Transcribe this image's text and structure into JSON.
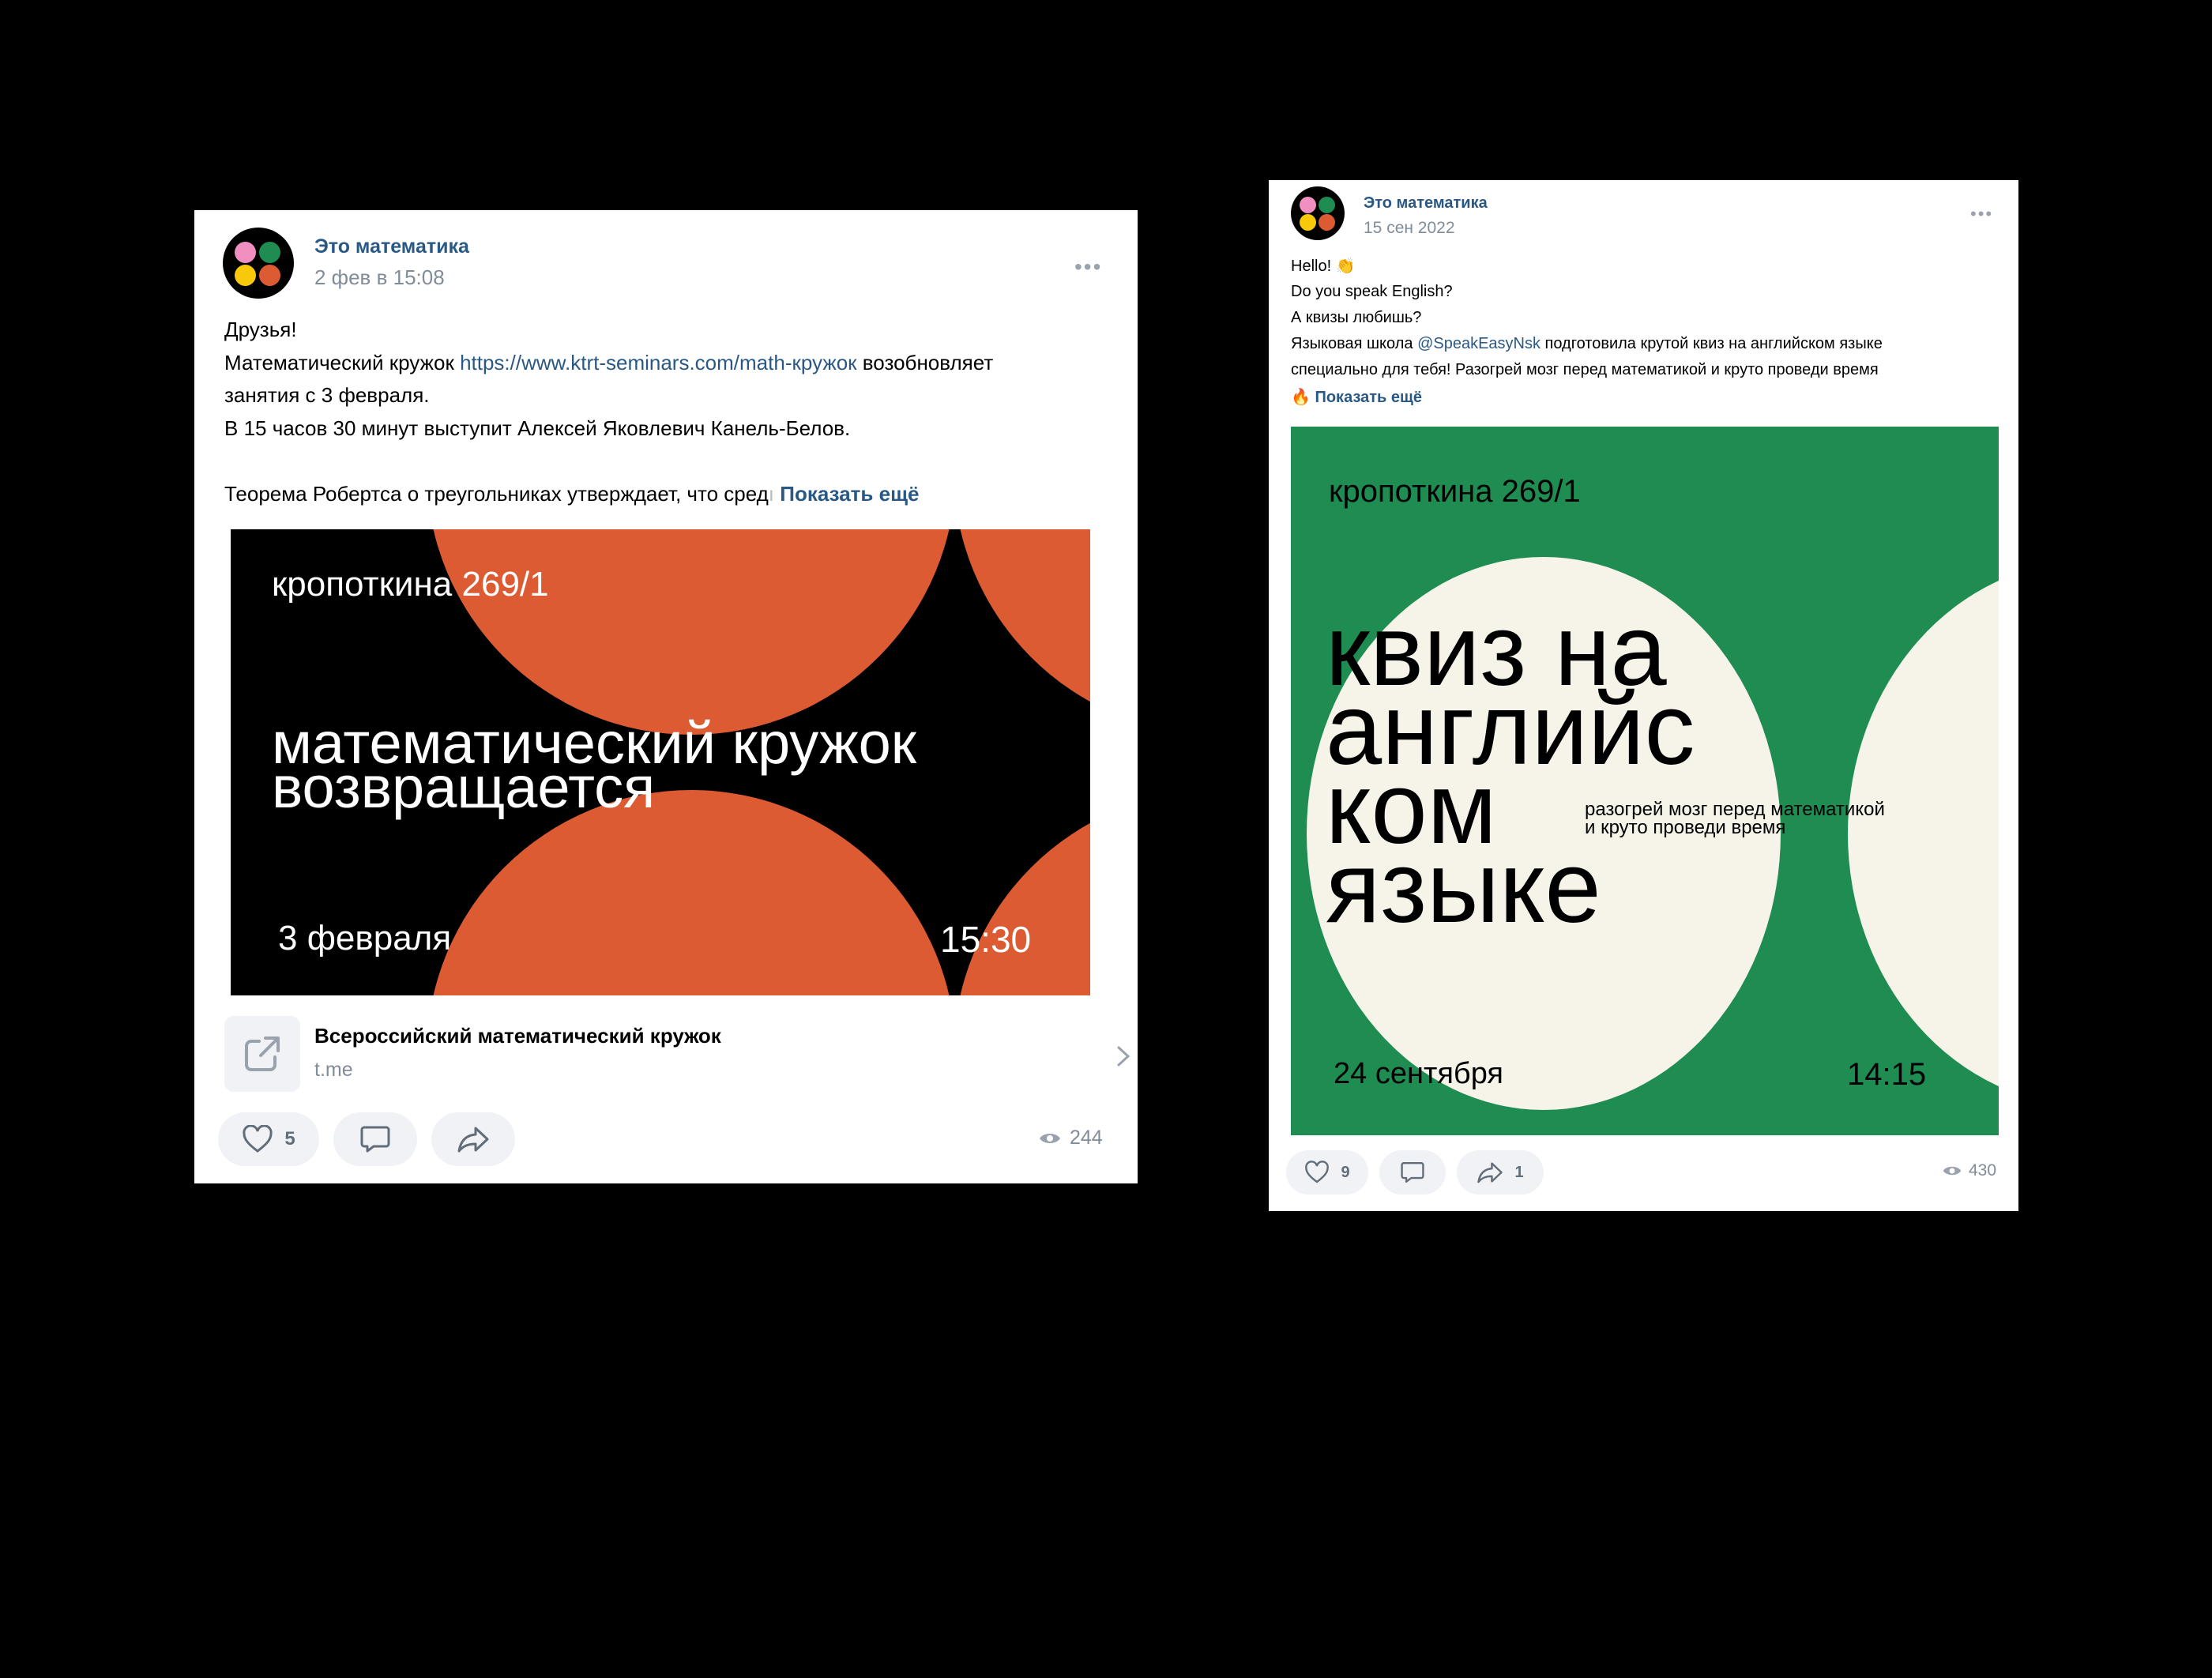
{
  "post1": {
    "author": "Это математика",
    "date": "2 фев в 15:08",
    "text": {
      "line1": "Друзья!",
      "line2_pre": "Математический кружок ",
      "line2_link": "https://www.ktrt-seminars.com/math-кружок",
      "line2_post": " возобновляет",
      "line3": "занятия с 3 февраля.",
      "line4": "В 15 часов 30 минут выступит Алексей Яковлевич Канель-Белов.",
      "line5": "Теорема Робертса о треугольниках утверждает, что сред",
      "show_more": "Показать ещё"
    },
    "banner": {
      "address": "кропоткина 269/1",
      "title_line1": "математический кружок",
      "title_line2": "возвращается",
      "date": "3 февраля",
      "time": "15:30",
      "colors": {
        "bg": "#000000",
        "accent": "#dc5b33",
        "text": "#ffffff"
      }
    },
    "attachment": {
      "title": "Всероссийский математический кружок",
      "domain": "t.me",
      "icon": "external-link-icon"
    },
    "actions": {
      "likes": "5",
      "views": "244"
    }
  },
  "post2": {
    "author": "Это математика",
    "date": "15 сен 2022",
    "text": {
      "line1": "Hello! 👏",
      "line2": "Do you speak English?",
      "line3": "А квизы любишь?",
      "line4_pre": "Языковая школа ",
      "line4_link": "@SpeakEasyNsk",
      "line4_post": " подготовила крутой квиз на английском языке",
      "line5": "специально для тебя! Разогрей мозг перед математикой и круто проведи время",
      "line6_emoji": "🔥",
      "show_more": "Показать ещё"
    },
    "banner": {
      "address": "кропоткина 269/1",
      "title_lines": [
        "квиз на",
        "английс",
        "ком",
        "языке"
      ],
      "subtitle_line1": "разогрей мозг перед математикой",
      "subtitle_line2": "и круто проведи время",
      "date": "24 сентября",
      "time": "14:15",
      "colors": {
        "bg": "#1f8c52",
        "accent": "#f6f3e8",
        "text": "#000000"
      }
    },
    "actions": {
      "likes": "9",
      "shares": "1",
      "views": "430"
    }
  },
  "avatar_colors": {
    "pink": "#f08fc0",
    "green": "#1f8c52",
    "yellow": "#f7c90a",
    "orange": "#dc5b33"
  },
  "icons": [
    "heart-icon",
    "comment-icon",
    "share-icon",
    "eye-icon",
    "more-icon",
    "chevron-right-icon"
  ]
}
